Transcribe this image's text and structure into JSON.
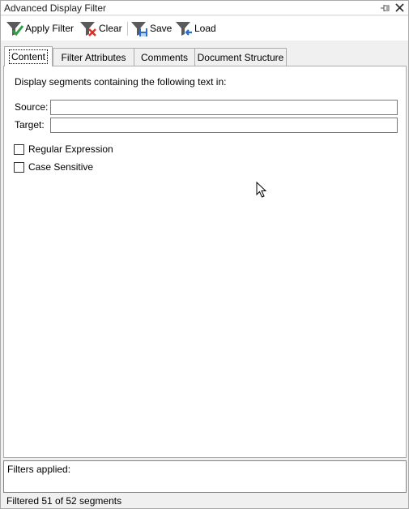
{
  "window": {
    "title": "Advanced Display Filter"
  },
  "toolbar": {
    "apply_label": "Apply Filter",
    "clear_label": "Clear",
    "save_label": "Save",
    "load_label": "Load"
  },
  "tabs": [
    {
      "label": "Content",
      "active": true
    },
    {
      "label": "Filter Attributes",
      "active": false
    },
    {
      "label": "Comments",
      "active": false
    },
    {
      "label": "Document Structure",
      "active": false
    }
  ],
  "content": {
    "intro": "Display segments containing the following text in:",
    "source_label": "Source:",
    "source_value": "",
    "target_label": "Target:",
    "target_value": "",
    "regex_label": "Regular Expression",
    "regex_checked": false,
    "case_label": "Case Sensitive",
    "case_checked": false
  },
  "filters": {
    "label": "Filters applied:"
  },
  "status": {
    "text": "Filtered 51 of 52 segments"
  },
  "colors": {
    "filter_icon": "#5a5a5a",
    "check_green": "#2e9e3e",
    "clear_red": "#d9322b",
    "save_blue": "#2c6fc4"
  }
}
